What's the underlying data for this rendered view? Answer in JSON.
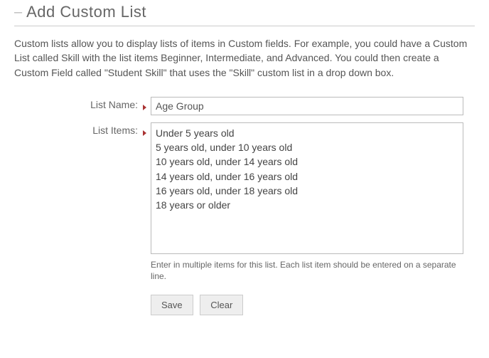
{
  "header": {
    "title": "Add Custom List"
  },
  "intro": "Custom lists allow you to display lists of items in Custom fields. For example, you could have a Custom List called Skill with the list items Beginner, Intermediate, and Advanced. You could then create a Custom Field called \"Student Skill\" that uses the \"Skill\" custom list in a drop down box.",
  "form": {
    "list_name": {
      "label": "List Name:",
      "value": "Age Group"
    },
    "list_items": {
      "label": "List Items:",
      "value": "Under 5 years old\n5 years old, under 10 years old\n10 years old, under 14 years old\n14 years old, under 16 years old\n16 years old, under 18 years old\n18 years or older",
      "hint": "Enter in multiple items for this list. Each list item should be entered on a separate line."
    }
  },
  "buttons": {
    "save": "Save",
    "clear": "Clear"
  }
}
